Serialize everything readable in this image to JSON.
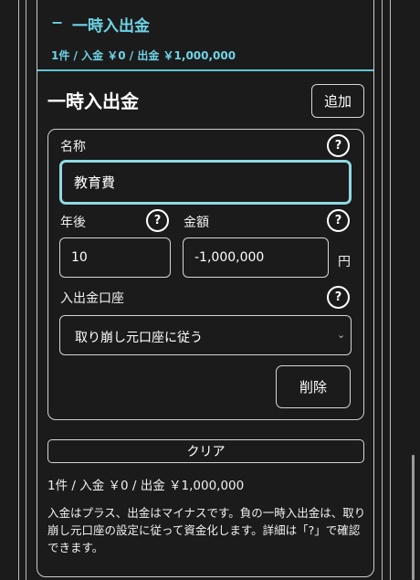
{
  "accordion": {
    "toggle": "−",
    "title": "一時入出金",
    "summary": "1件 / 入金 ￥0 / 出金 ￥1,000,000"
  },
  "section": {
    "title": "一時入出金",
    "add_label": "追加"
  },
  "entry": {
    "name_label": "名称",
    "name_value": "教育費",
    "years_label": "年後",
    "years_value": "10",
    "amount_label": "金額",
    "amount_value": "-1,000,000",
    "amount_unit": "円",
    "account_label": "入出金口座",
    "account_value": "取り崩し元口座に従う",
    "delete_label": "削除",
    "help_glyph": "?"
  },
  "footer": {
    "clear_label": "クリア",
    "summary": "1件 / 入金 ￥0 / 出金 ￥1,000,000",
    "help_text": "入金はプラス、出金はマイナスです。負の一時入出金は、取り崩し元口座の設定に従って資金化します。詳細は「?」で確認できます。"
  },
  "icons": {
    "help": "help-circle-icon",
    "select_chevron": "chevron-down-icon"
  },
  "colors": {
    "background": "#1b1b1b",
    "accent": "#6ed3e6",
    "focus_border": "#8fd9e4",
    "text": "#f2f2f2"
  }
}
